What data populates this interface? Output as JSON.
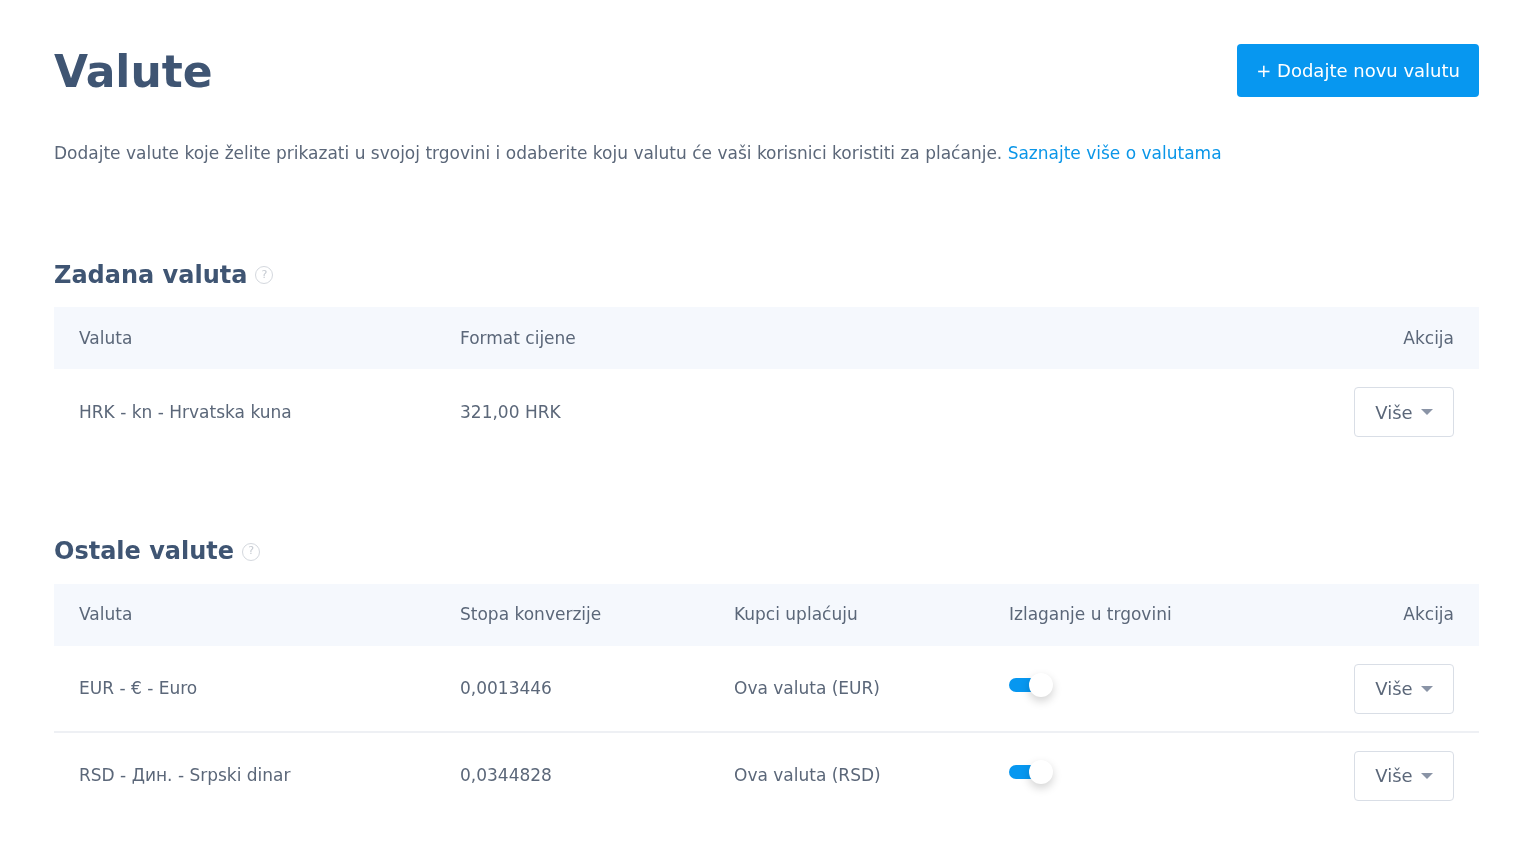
{
  "title": "Valute",
  "add_button": "+ Dodajte novu valutu",
  "description": {
    "text": "Dodajte valute koje želite prikazati u svojoj trgovini i odaberite koju valutu će vaši korisnici koristiti za plaćanje.",
    "link": "Saznajte više o valutama"
  },
  "sections": [
    {
      "title": "Zadana valuta",
      "help_icon": "?",
      "columns": [
        "Valuta",
        "Format cijene",
        "Akcija"
      ],
      "rows": [
        {
          "cells": [
            "HRK - kn - Hrvatska kuna",
            "321,00 HRK"
          ],
          "action": "Više"
        }
      ]
    },
    {
      "title": "Ostale valute",
      "help_icon": "?",
      "columns": [
        "Valuta",
        "Stopa konverzije",
        "Kupci uplaćuju",
        "Izlaganje u trgovini",
        "Akcija"
      ],
      "rows": [
        {
          "cells": [
            "EUR - € - Euro",
            "0,0013446",
            "Ova valuta (EUR)"
          ],
          "on": true,
          "action": "Više"
        },
        {
          "cells": [
            "RSD - Дин. - Srpski dinar",
            "0,0344828",
            "Ova valuta (RSD)"
          ],
          "on": true,
          "action": "Više"
        }
      ]
    }
  ]
}
